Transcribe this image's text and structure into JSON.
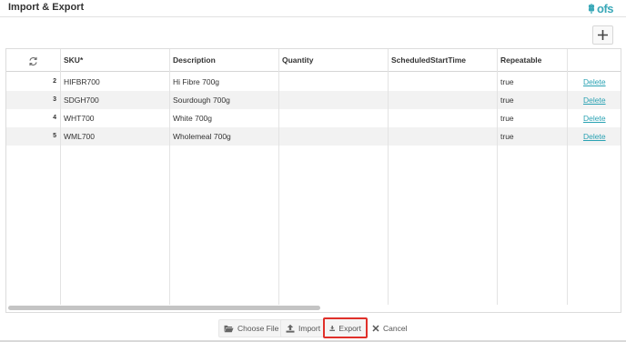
{
  "window": {
    "title": "Import & Export",
    "brand": "ofs"
  },
  "grid": {
    "columns": [
      "SKU*",
      "Description",
      "Quantity",
      "ScheduledStartTime",
      "Repeatable"
    ],
    "rows": [
      {
        "num": "2",
        "sku": "HIFBR700",
        "description": "Hi Fibre 700g",
        "quantity": "",
        "scheduled": "",
        "repeatable": "true",
        "action": "Delete"
      },
      {
        "num": "3",
        "sku": "SDGH700",
        "description": "Sourdough 700g",
        "quantity": "",
        "scheduled": "",
        "repeatable": "true",
        "action": "Delete"
      },
      {
        "num": "4",
        "sku": "WHT700",
        "description": "White 700g",
        "quantity": "",
        "scheduled": "",
        "repeatable": "true",
        "action": "Delete"
      },
      {
        "num": "5",
        "sku": "WML700",
        "description": "Wholemeal 700g",
        "quantity": "",
        "scheduled": "",
        "repeatable": "true",
        "action": "Delete"
      }
    ]
  },
  "footer": {
    "choose_file": "Choose File",
    "import": "Import",
    "export": "Export",
    "cancel": "Cancel"
  },
  "icons": {
    "add": "plus-icon",
    "refresh": "refresh-icon",
    "choose_file": "folder-open-icon",
    "import": "upload-icon",
    "export": "download-icon",
    "cancel": "close-icon"
  },
  "colors": {
    "accent": "#2aa2b3",
    "highlight": "#e0302a",
    "alt_row": "#f2f2f2"
  }
}
